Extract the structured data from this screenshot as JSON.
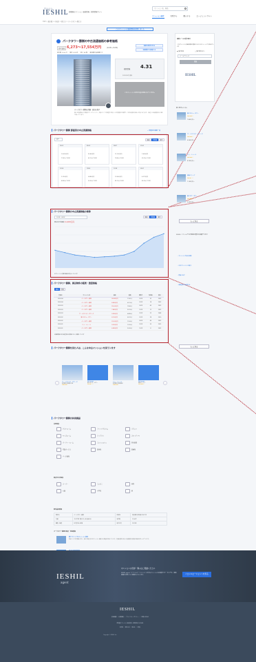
{
  "header": {
    "logo_small": "マンション",
    "logo": "IESHIL",
    "tagline": "首都圏のマンション価格情報・相場情報サイト",
    "search_placeholder": "マンション名、駅名",
    "nav": [
      "マンション検索",
      "住所から",
      "購入する",
      "エージェントサイト"
    ],
    "nav_active_index": 0,
    "breadcrumb": "TOP > 東京都 > 中央区 > 勝どき > パークタワー勝どき"
  },
  "notice": "このマンションの価格情報を更新しました",
  "summary": {
    "title": "パークタワー勝鬨の中古流通価格の参考価格",
    "price_label": "参考価格",
    "price": "6,273〜17,554万円",
    "price_unit": "(1LDK〜3LDK)",
    "btn1": "価格の推移を見る",
    "btn2": "価格査定を依頼する",
    "meta": "総戸数 1106 戸 ・ 築年 2023年 ・ 地上 58 階 ・ 東京都中央区勝どき",
    "rate_label": "相場情報",
    "rate_value": "4.31",
    "rate_note": "2025年4月 更新",
    "grey_note": "このマンションの室内写真は登録されていません",
    "caption": "パークタワー勝鬨の外観・周辺の様子",
    "description": "勝どき駅直結の大規模タワーマンション。湾岸エリアの眺望と充実した共用施設が特徴で、生活利便性の高い立地にあります。周辺には商業施設や公園が揃っています。"
  },
  "sections": {
    "list_title": "パークタワー勝鬨 部屋別の中古流通価格",
    "list_link": "> 部屋別の価格一覧",
    "chart_title": "パークタワー勝鬨の中古流通価格の推移",
    "table_title": "パークタワー勝鬨、周辺物件の販売・賃貸価格",
    "similar_title": "パークタワー勝鬨を見た人は、こんな中古マンションを見ています",
    "facilities_title": "パークタワー勝鬨の共用施設",
    "info_title": "物件基本情報",
    "news_title": "パークタワー勝鬨の周辺・地域情報"
  },
  "room_grid": {
    "floor_select": "全て",
    "toggles": [
      "価格",
      "坪単価",
      "築年"
    ],
    "toggle_active": 1,
    "cells": [
      {
        "head": "5503",
        "l1": "10,090万円",
        "l2": "72.41㎡ 2LDK"
      },
      {
        "head": "4505",
        "l1": "8,540万円",
        "l2": "62.10㎡ 2LDK"
      },
      {
        "head": "3807",
        "l1": "11,230万円",
        "l2": "78.65㎡ 3LDK"
      },
      {
        "head": "2902",
        "l1": "7,650万円",
        "l2": "55.20㎡ 1LDK"
      },
      {
        "head": "2204",
        "l1": "9,120万円",
        "l2": "68.80㎡ 2LDK"
      },
      {
        "head": "1806",
        "l1": "6,880万円",
        "l2": "50.30㎡ 1LDK"
      },
      {
        "head": "1208",
        "l1": "12,400万円",
        "l2": "85.10㎡ 3LDK"
      },
      {
        "head": "0501",
        "l1": "6,273万円",
        "l2": "45.00㎡ 1LDK"
      }
    ]
  },
  "chart_data": {
    "type": "area",
    "title": "",
    "ylabel": "",
    "xlabel": "",
    "x": [
      "2020/01",
      "2020/07",
      "2021/01",
      "2021/07",
      "2022/01",
      "2022/07",
      "2023/01",
      "2023/07",
      "2024/01",
      "2024/07",
      "2025/01",
      "2025/04"
    ],
    "values": [
      1050,
      1030,
      1010,
      1000,
      990,
      995,
      1000,
      1010,
      1040,
      1110,
      1160,
      1190
    ],
    "ylim": [
      900,
      1250
    ],
    "grid": true,
    "selector": "1LDK〜3LDK",
    "current_label": "現在の平均価格",
    "current_value": "11,400万円",
    "note": "※マンションの推定価格を表示しています"
  },
  "listing_table": {
    "tabs": [
      "販売",
      "賃貸"
    ],
    "headers": [
      "登録日",
      "マンション名",
      "価格",
      "面積",
      "間取り",
      "所在階",
      "築年"
    ],
    "rows": [
      [
        "2025/04",
        "パークタワー勝鬨",
        "10,980万円",
        "72.41㎡",
        "2LDK",
        "32",
        "2023"
      ],
      [
        "2025/04",
        "パークタワー勝鬨",
        "8,980万円",
        "62.10㎡",
        "2LDK",
        "18",
        "2023"
      ],
      [
        "2025/03",
        "パークタワー勝鬨",
        "12,500万円",
        "78.65㎡",
        "3LDK",
        "45",
        "2023"
      ],
      [
        "2025/03",
        "パークタワー勝鬨",
        "7,480万円",
        "55.20㎡",
        "1LDK",
        "12",
        "2023"
      ],
      [
        "2025/03",
        "ザ・トウキョウ・タワーズ",
        "9,280万円",
        "68.80㎡",
        "2LDK",
        "22",
        "2008"
      ],
      [
        "2025/02",
        "勝どきビュータワー",
        "8,100万円",
        "60.15㎡",
        "2LDK",
        "28",
        "2010"
      ],
      [
        "2025/02",
        "パークタワー勝鬨",
        "11,200万円",
        "75.00㎡",
        "3LDK",
        "40",
        "2023"
      ],
      [
        "2025/01",
        "ドゥ・トゥール",
        "9,500万円",
        "70.20㎡",
        "2LDK",
        "35",
        "2015"
      ],
      [
        "2025/01",
        "パークタワー勝鬨",
        "6,980万円",
        "50.30㎡",
        "1LDK",
        "8",
        "2023"
      ]
    ],
    "footnote": "※掲載情報は各不動産会社の情報をもとに掲載しています"
  },
  "carousel": [
    {
      "title": "ザ・トウキョウ・タワーズ",
      "sub": "東京都中央区勝どき6",
      "stars": "★★★★☆"
    },
    {
      "title": "No Image",
      "sub": "勝どきビュータワー",
      "stars": "★★★☆☆"
    },
    {
      "title": "ドゥ・トゥール",
      "sub": "東京都中央区晴海2",
      "stars": "★★★★☆"
    },
    {
      "title": "No Image",
      "sub": "晴海フラッグ",
      "stars": "★★★★☆"
    }
  ],
  "facilities": {
    "group1": "共用施設",
    "items1": [
      "ゲストルーム",
      "フィットネスジム",
      "ラウンジ",
      "キッズルーム",
      "ライブラリ",
      "スカイデッキ",
      "パーティールーム",
      "コンシェルジュ",
      "防災倉庫",
      "宅配ボックス",
      "駐車場",
      "駐輪場",
      "バイク置場"
    ],
    "group2": "周辺の生活施設",
    "items2": [
      "スーパー",
      "コンビニ",
      "病院",
      "公園",
      "小学校",
      "駅"
    ]
  },
  "info": {
    "rows": [
      [
        "物件名",
        "パークタワー勝鬨",
        "所在地",
        "東京都中央区勝どき4丁目"
      ],
      [
        "交通",
        "大江戸線「勝どき」駅 徒歩2分",
        "総戸数",
        "1106戸"
      ],
      [
        "構造・階建",
        "RC造 地上58階",
        "竣工年月",
        "2023年"
      ]
    ]
  },
  "news": [
    {
      "title": "勝どきエリアのマンション相場",
      "text": "湾岸エリアの再開発に伴い、勝どき周辺の中古マンション価格は上昇傾向が続いています。交通利便性の向上や商業施設の開業が価格を押し上げています。"
    },
    {
      "title": "周辺の再開発情報",
      "text": "晴海・勝どきエリアでは複数の大規模再開発が進行中です。"
    }
  ],
  "sidebar": {
    "title": "価格メールを受け取る",
    "text": "このマンションの価格情報が更新されたときにメールでお知らせします",
    "radio1": "受け取る",
    "radio2": "受け取らない",
    "email_placeholder": "メールアドレス",
    "submit": "登録",
    "logo": "IESHIL",
    "related_title": "近くのマンション",
    "related": [
      {
        "name": "勝どきビュータワー",
        "stars": "★★★★☆",
        "price": "7,800万円〜"
      },
      {
        "name": "ザ・トウキョウ・タワーズ",
        "stars": "★★★★☆",
        "price": "6,900万円〜"
      },
      {
        "name": "ドゥ・トゥール",
        "stars": "★★★★☆",
        "price": "8,200万円〜"
      },
      {
        "name": "晴海フラッグ",
        "stars": "★★★☆☆",
        "price": "7,100万円〜"
      },
      {
        "name": "勝どきザ・タワー",
        "stars": "★★★★☆",
        "price": "9,400万円〜"
      }
    ],
    "more_btn": "もっと見る",
    "agent_title": "IESHIL(イエシル)では不動産の査定を依頼できます",
    "agent_list": [
      "マンション売却の相場",
      "中古マンションを買う",
      "賃貸に出す",
      "価格査定を依頼する"
    ],
    "more_btn2": "もっと見る"
  },
  "footer": {
    "hero_logo": "IESHIL",
    "hero_agent": "agent",
    "hero_text": "マンションの売却・購入はご相談ください",
    "hero_sub": "IESHIL agent（イエシルエージェント）は中古マンションの売買仲介サービスです。価格情報を活用したご提案をいたします。",
    "cta": "イエシルエージェントを見る",
    "logo": "IESHIL",
    "links": "会社概要 ｜ 利用規約 ｜ プライバシーポリシー ｜ お問い合わせ",
    "small1": "首都圏のマンション価格情報・相場情報ならIESHIL",
    "small2": "東京都 ｜ 神奈川県 ｜ 埼玉県 ｜ 千葉県",
    "copyright": "Copyright © IESHIL Inc."
  }
}
